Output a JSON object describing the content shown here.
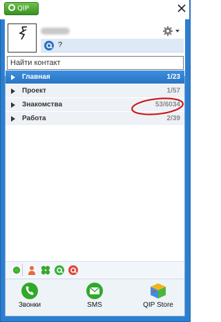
{
  "title_bar": {
    "logo_label": "QIP"
  },
  "profile": {
    "status_text": "?"
  },
  "search": {
    "placeholder": "Найти контакт"
  },
  "groups": [
    {
      "name": "Главная",
      "count": "1/23"
    },
    {
      "name": "Проект",
      "count": "1/57"
    },
    {
      "name": "Знакомства",
      "count": "53/6034"
    },
    {
      "name": "Работа",
      "count": "2/39"
    }
  ],
  "bottom_bar": {
    "calls_label": "Звонки",
    "sms_label": "SMS",
    "store_label": "QIP Store"
  },
  "colors": {
    "window_frame": "#2c7fd0",
    "active_group": "#2f80d1",
    "annotation": "#cc1a1a"
  }
}
